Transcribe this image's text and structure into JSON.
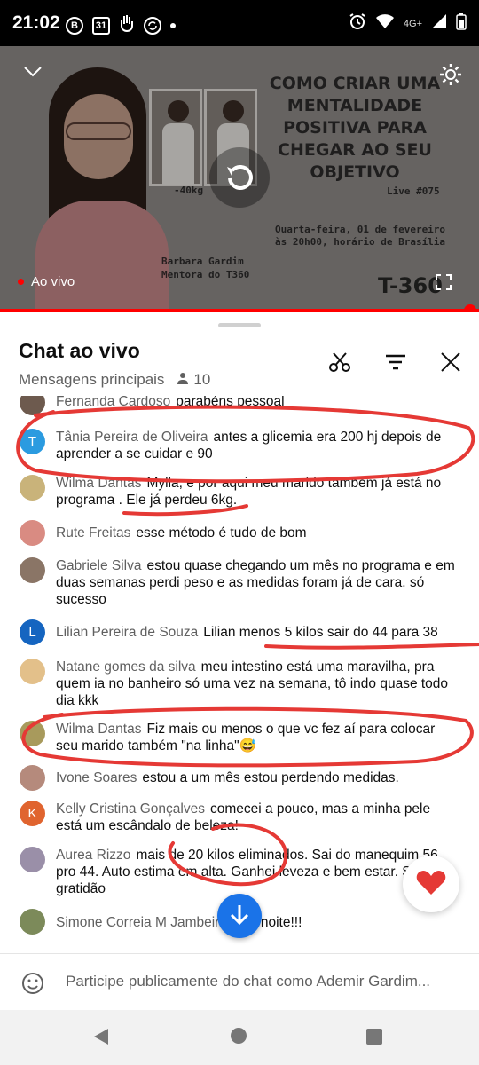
{
  "status_bar": {
    "time": "21:02",
    "icons": [
      "b-circle-icon",
      "calendar-31-icon",
      "hand-icon",
      "sync-icon",
      "dot-icon"
    ],
    "calendar_day": "31",
    "b_badge": "B",
    "network": "4G+",
    "right_icons": [
      "alarm-icon",
      "wifi-icon",
      "signal-icon",
      "battery-icon"
    ]
  },
  "video": {
    "title_text": "COMO CRIAR UMA MENTALIDADE POSITIVA PARA CHEGAR AO SEU OBJETIVO",
    "live_number": "Live #075",
    "date_line1": "Quarta-feira, 01 de fevereiro",
    "date_line2": "às 20h00, horário de Brasília",
    "presenter_name": "Barbara Gardim",
    "presenter_role": "Mentora do T360",
    "weight_caption": "-40kg",
    "brand": "T-360",
    "live_label": "Ao vivo",
    "progress": 1.0
  },
  "chat": {
    "title": "Chat ao vivo",
    "mode": "Mensagens principais",
    "viewer_count": "10",
    "messages": [
      {
        "author": "Fernanda Cardoso",
        "text": "parabéns pessoal",
        "avatar_color": "#6d5a4e",
        "avatar_letter": ""
      },
      {
        "author": "Tânia Pereira de Oliveira",
        "text": "antes a glicemia era 200 hj depois de aprender a se cuidar e 90",
        "avatar_color": "#2b9be0",
        "avatar_letter": "T"
      },
      {
        "author": "Wilma Dantas",
        "text": "Mylla, e por aqui meu marido também já está no programa . Ele já perdeu 6kg.",
        "avatar_color": "#c9b37a",
        "avatar_letter": ""
      },
      {
        "author": "Rute Freitas",
        "text": "esse método é tudo de bom",
        "avatar_color": "#d98b82",
        "avatar_letter": ""
      },
      {
        "author": "Gabriele Silva",
        "text": "estou quase chegando um mês no programa e em duas semanas perdi peso e as medidas foram já de cara. só sucesso",
        "avatar_color": "#8a7566",
        "avatar_letter": ""
      },
      {
        "author": "Lilian Pereira de Souza",
        "text": "Lilian menos 5 kilos sair do 44 para 38",
        "avatar_color": "#1565c0",
        "avatar_letter": "L"
      },
      {
        "author": "Natane gomes da silva",
        "text": "meu intestino está uma maravilha, pra quem ia no banheiro só uma vez na semana, tô indo quase todo dia kkk",
        "avatar_color": "#e3c08a",
        "avatar_letter": ""
      },
      {
        "author": "Wilma Dantas",
        "text": "Fiz mais ou menos o que vc fez aí para colocar seu marido também \"na linha\"😅",
        "avatar_color": "#a89a5c",
        "avatar_letter": ""
      },
      {
        "author": "Ivone Soares",
        "text": "estou a um mês estou perdendo medidas.",
        "avatar_color": "#b58a7c",
        "avatar_letter": ""
      },
      {
        "author": "Kelly Cristina Gonçalves",
        "text": "comecei a pouco, mas a minha pele está um escândalo de beleza!",
        "avatar_color": "#e0642f",
        "avatar_letter": "K"
      },
      {
        "author": "Aurea Rizzo",
        "text": "mais de 20 kilos eliminados. Sai do manequim 56 pro 44. Auto estima em alta. Ganhei leveza e bem estar. Só gratidão",
        "avatar_color": "#9a8fa8",
        "avatar_letter": ""
      },
      {
        "author": "Simone Correia M Jambeiro",
        "text": "Boa noite!!!",
        "avatar_color": "#7c8a5a",
        "avatar_letter": ""
      }
    ],
    "input_placeholder": "Participe publicamente do chat como Ademir Gardim..."
  },
  "colors": {
    "accent_red": "#ff0000",
    "scroll_blue": "#1a73e8",
    "annotation_red": "#e53935"
  }
}
